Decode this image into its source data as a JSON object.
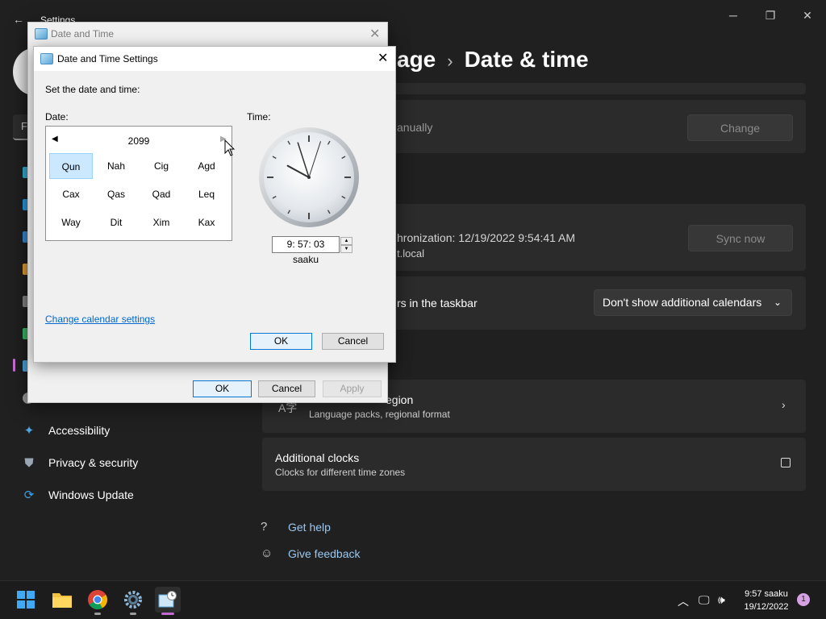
{
  "settings": {
    "window_title": "Settings",
    "breadcrumb_part": "age",
    "page_title": "Date & time",
    "search_initial": "F",
    "set_time_text": "anually",
    "change_label": "Change",
    "sync_text": "hronization: 12/19/2022 9:54:41 AM",
    "sync_server": "t.local",
    "sync_label": "Sync now",
    "calendars_text": "rs in the taskbar",
    "calendars_value": "Don't show additional calendars",
    "language_title": "egion",
    "language_sub": "Language packs, regional format",
    "clocks_title": "Additional clocks",
    "clocks_sub": "Clocks for different time zones",
    "help": "Get help",
    "feedback": "Give feedback"
  },
  "sidebar": {
    "items": [
      {
        "label": "Accessibility",
        "icon": "accessibility-icon"
      },
      {
        "label": "Privacy & security",
        "icon": "shield-icon"
      },
      {
        "label": "Windows Update",
        "icon": "update-icon"
      }
    ]
  },
  "outer_dialog": {
    "title": "Date and Time",
    "ok": "OK",
    "cancel": "Cancel",
    "apply": "Apply"
  },
  "inner_dialog": {
    "title": "Date and Time Settings",
    "instruction": "Set the date and time:",
    "date_label": "Date:",
    "time_label": "Time:",
    "year": "2099",
    "months": [
      "Qun",
      "Nah",
      "Cig",
      "Agd",
      "Cax",
      "Qas",
      "Qad",
      "Leq",
      "Way",
      "Dit",
      "Xim",
      "Kax"
    ],
    "selected_month": "Qun",
    "time_value": "9: 57: 03 saaku",
    "clock_time": {
      "hour": 9,
      "minute": 57,
      "second": 3
    },
    "calendar_link": "Change calendar settings",
    "ok": "OK",
    "cancel": "Cancel"
  },
  "taskbar": {
    "time": "9:57 saaku",
    "date": "19/12/2022",
    "notifications": "1"
  },
  "colors": {
    "accent": "#c36bd3",
    "link_dark": "#99c8f2",
    "link_light": "#0066cc"
  }
}
